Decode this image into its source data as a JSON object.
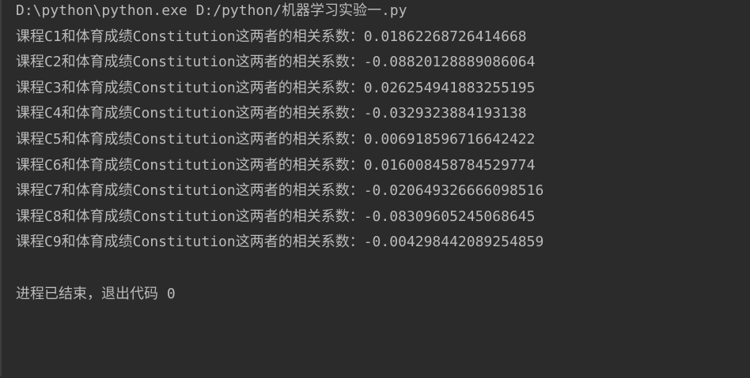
{
  "console": {
    "command": "D:\\python\\python.exe D:/python/机器学习实验一.py",
    "lines": [
      "课程C1和体育成绩Constitution这两者的相关系数：0.0186226872641466​8",
      "课程C2和体育成绩Constitution这两者的相关系数：-0.08820128889086064",
      "课程C3和体育成绩Constitution这两者的相关系数：0.026254941883255195",
      "课程C4和体育成绩Constitution这两者的相关系数：-0.0329323884193138",
      "课程C5和体育成绩Constitution这两者的相关系数：0.006918596716642422",
      "课程C6和体育成绩Constitution这两者的相关系数：0.016008458784529774",
      "课程C7和体育成绩Constitution这两者的相关系数：-0.020649326666098516",
      "课程C8和体育成绩Constitution这两者的相关系数：-0.08309605245068645",
      "课程C9和体育成绩Constitution这两者的相关系数：-0.004298442089254859"
    ],
    "exit_message": "进程已结束，退出代码 0"
  }
}
